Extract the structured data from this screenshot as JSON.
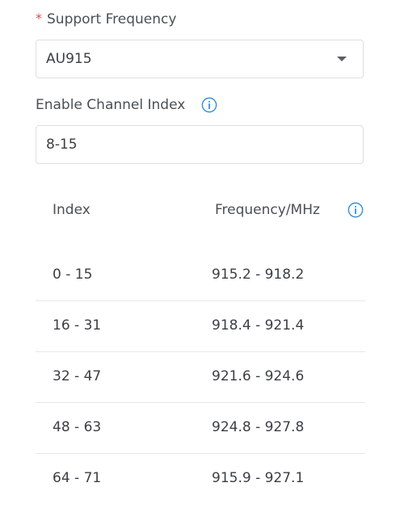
{
  "support_frequency": {
    "required_mark": "*",
    "label": "Support Frequency",
    "selected_value": "AU915"
  },
  "enable_channel_index": {
    "label": "Enable Channel Index",
    "value": "8-15"
  },
  "channel_table": {
    "headers": {
      "index": "Index",
      "frequency": "Frequency/MHz"
    },
    "rows": [
      {
        "index": "0 - 15",
        "frequency": "915.2 - 918.2"
      },
      {
        "index": "16 - 31",
        "frequency": "918.4 - 921.4"
      },
      {
        "index": "32 - 47",
        "frequency": "921.6 - 924.6"
      },
      {
        "index": "48 - 63",
        "frequency": "924.8 - 927.8"
      },
      {
        "index": "64 - 71",
        "frequency": "915.9 - 927.1"
      }
    ]
  },
  "icons": {
    "info": "info-circle-icon",
    "dropdown": "chevron-down-icon"
  },
  "colors": {
    "accent": "#3a8fd9",
    "required": "#e5484d",
    "border": "#dcdfe4"
  }
}
